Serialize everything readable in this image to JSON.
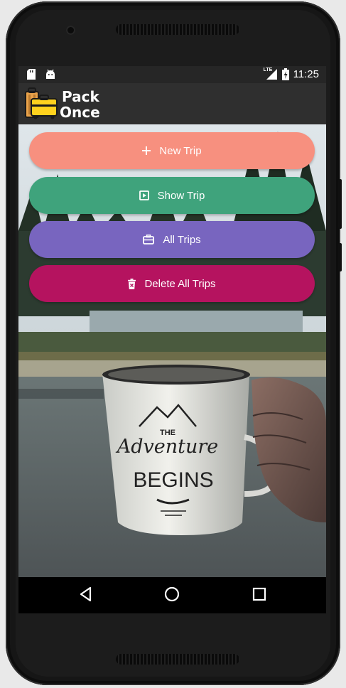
{
  "status_bar": {
    "time": "11:25",
    "network_label": "LTE",
    "icons": [
      "sd-card-icon",
      "android-icon",
      "signal-icon",
      "battery-charging-icon"
    ]
  },
  "app": {
    "name_line1": "Pack",
    "name_line2": "Once",
    "logo_icon": "suitcase-logo-icon"
  },
  "buttons": [
    {
      "label": "New Trip",
      "icon": "plus-icon",
      "color": "#F7907F"
    },
    {
      "label": "Show Trip",
      "icon": "play-box-icon",
      "color": "#3FA37C"
    },
    {
      "label": "All Trips",
      "icon": "briefcase-icon",
      "color": "#7865BF"
    },
    {
      "label": "Delete All Trips",
      "icon": "trash-icon",
      "color": "#B5135F"
    }
  ],
  "background_mug": {
    "line1": "THE",
    "line2": "Adventure",
    "line3": "BEGINS"
  },
  "nav_bar": {
    "icons": [
      "back-icon",
      "home-icon",
      "recents-icon"
    ]
  }
}
